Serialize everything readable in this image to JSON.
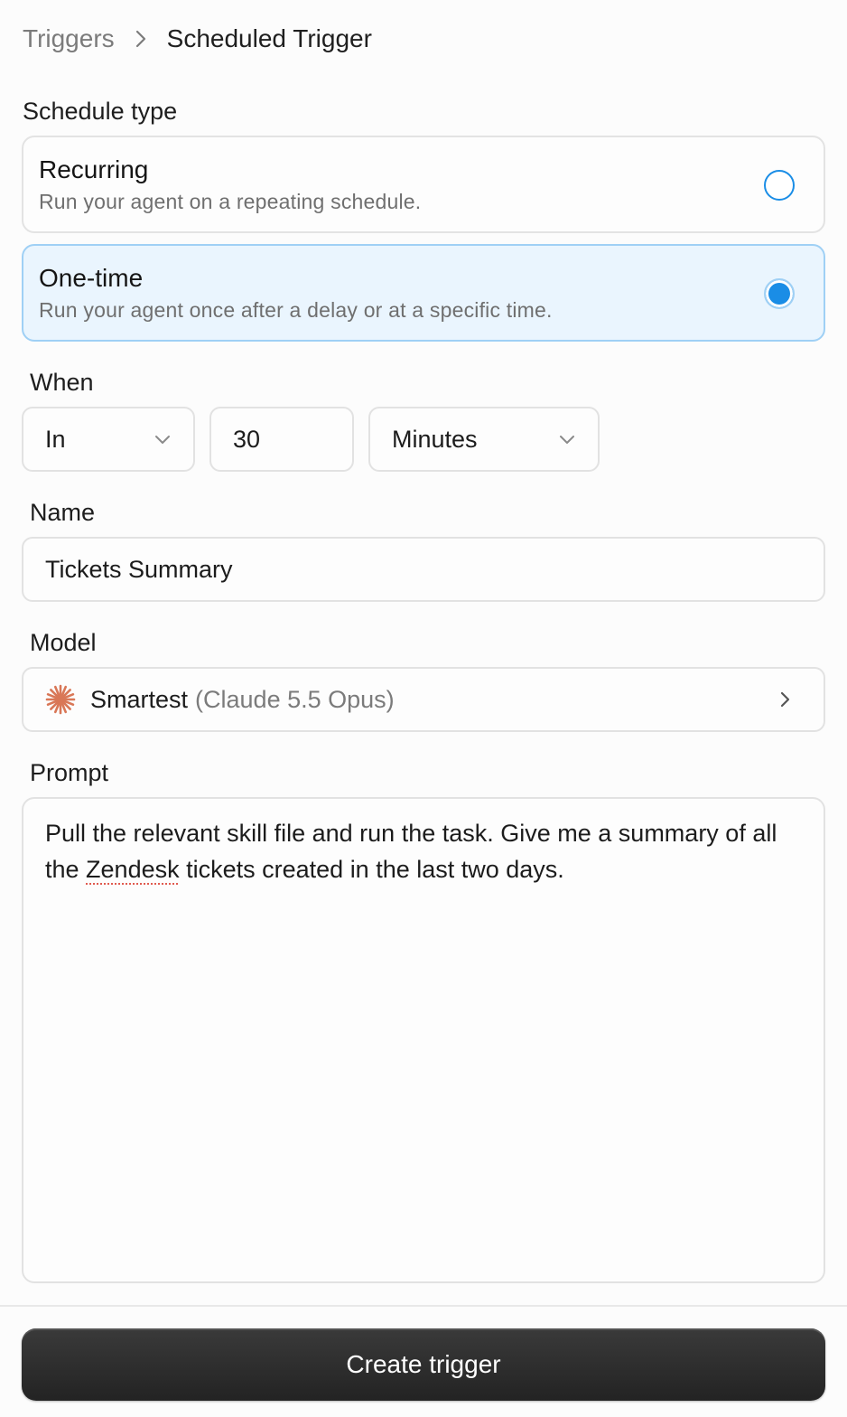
{
  "breadcrumb": {
    "parent": "Triggers",
    "current": "Scheduled Trigger"
  },
  "schedule": {
    "label": "Schedule type",
    "options": [
      {
        "title": "Recurring",
        "description": "Run your agent on a repeating schedule.",
        "selected": false
      },
      {
        "title": "One-time",
        "description": "Run your agent once after a delay or at a specific time.",
        "selected": true
      }
    ]
  },
  "when": {
    "label": "When",
    "mode": "In",
    "amount": "30",
    "unit": "Minutes"
  },
  "name": {
    "label": "Name",
    "value": "Tickets Summary"
  },
  "model": {
    "label": "Model",
    "name": "Smartest",
    "detail": "(Claude 5.5 Opus)",
    "icon": "sparkle-icon",
    "icon_color": "#d97757"
  },
  "prompt": {
    "label": "Prompt",
    "before": "Pull the relevant skill file and run the task. Give me a summary of all the ",
    "misspelled": "Zendesk",
    "after": " tickets created in the last two days."
  },
  "actions": {
    "create_label": "Create trigger"
  },
  "colors": {
    "accent": "#1a8de6",
    "selected_bg": "#eaf5fe",
    "button_bg": "#2b2b2b"
  }
}
